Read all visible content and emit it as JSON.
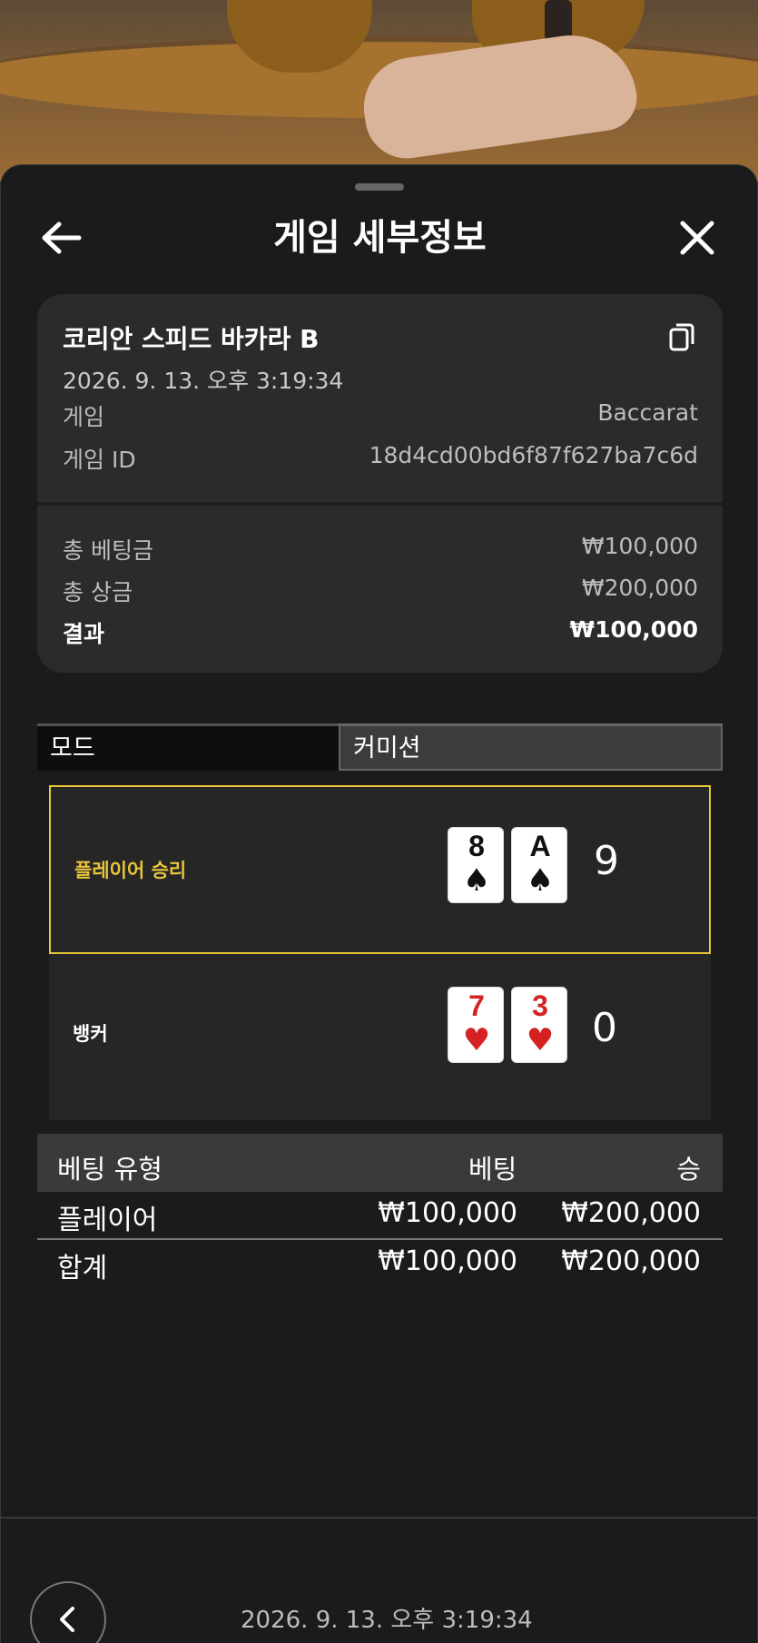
{
  "header": {
    "title": "게임 세부정보"
  },
  "summary": {
    "game_name": "코리안 스피드 바카라 B",
    "date": "2026. 9. 13. 오후 3:19:34",
    "game_label": "게임",
    "game_value": "Baccarat",
    "game_id_label": "게임 ID",
    "game_id_value": "18d4cd00bd6f87f627ba7c6d",
    "total_bet_label": "총 베팅금",
    "total_bet_value": "₩100,000",
    "total_win_label": "총 상금",
    "total_win_value": "₩200,000",
    "result_label": "결과",
    "result_value": "₩100,000"
  },
  "tabs": {
    "mode": "모드",
    "commission": "커미션"
  },
  "hands": {
    "player": {
      "label": "플레이어 승리",
      "score": "9",
      "cards": [
        {
          "rank": "8",
          "suit": "♠",
          "color": "#111111"
        },
        {
          "rank": "A",
          "suit": "♠",
          "color": "#111111"
        }
      ]
    },
    "banker": {
      "label": "뱅커",
      "score": "0",
      "cards": [
        {
          "rank": "7",
          "suit": "♥",
          "color": "#d42222"
        },
        {
          "rank": "3",
          "suit": "♥",
          "color": "#d42222"
        }
      ]
    },
    "winner_color": "#e7c63a"
  },
  "bets": {
    "headers": {
      "type": "베팅 유형",
      "bet": "베팅",
      "win": "승"
    },
    "rows": [
      {
        "type": "플레이어",
        "bet": "₩100,000",
        "win": "₩200,000"
      }
    ],
    "total": {
      "type": "합계",
      "bet": "₩100,000",
      "win": "₩200,000"
    }
  },
  "footer": {
    "date": "2026. 9. 13. 오후 3:19:34"
  },
  "icons": {
    "back": "arrow-left-icon",
    "close": "close-icon",
    "copy": "copy-icon",
    "footer_back": "chevron-left-icon"
  }
}
